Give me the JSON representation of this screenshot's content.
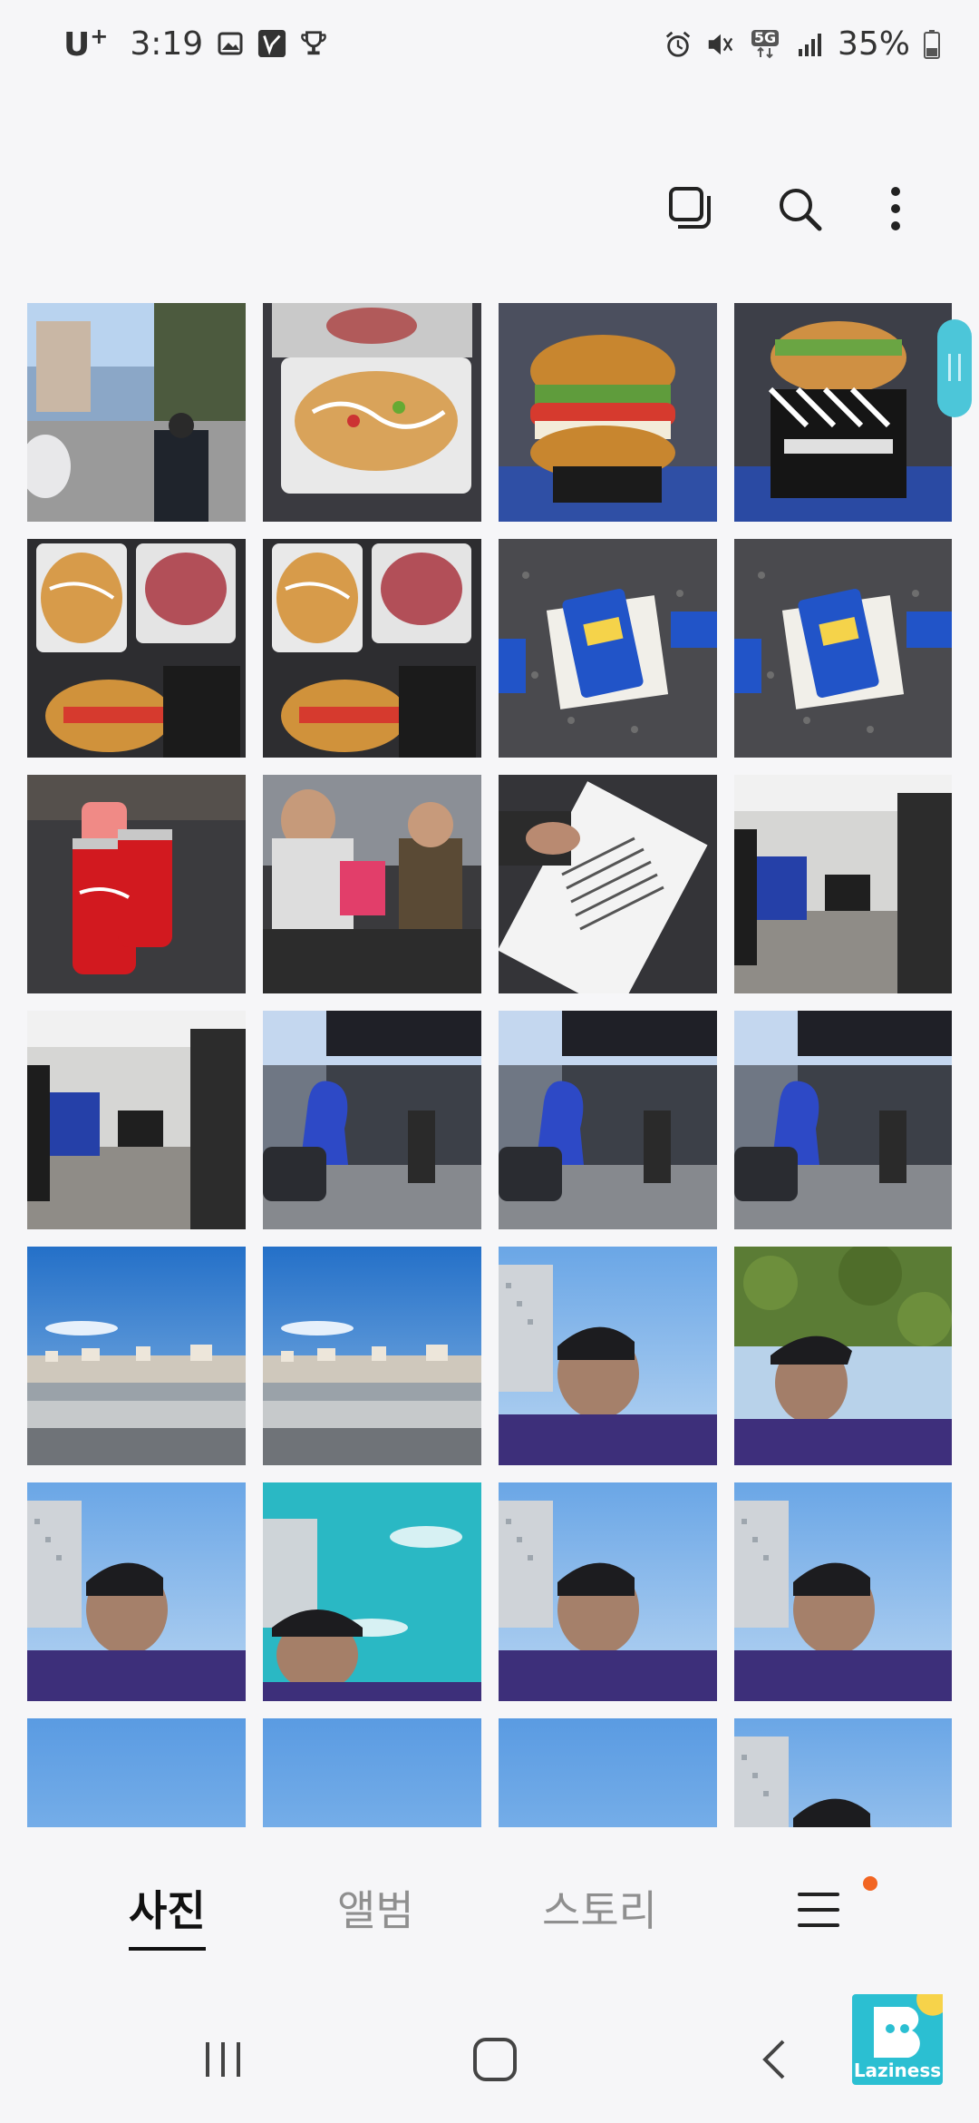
{
  "status_bar": {
    "carrier": "U",
    "carrier_sup": "+",
    "time": "3:19",
    "network": "5G",
    "battery": "35%"
  },
  "toolbar": {
    "icons": [
      "select-icon",
      "search-icon",
      "more-options-icon"
    ]
  },
  "grid": {
    "rows": 7,
    "columns": 4,
    "photos": [
      {
        "scene": "street"
      },
      {
        "scene": "food-tray"
      },
      {
        "scene": "burger"
      },
      {
        "scene": "burger-wrapped"
      },
      {
        "scene": "food-platter"
      },
      {
        "scene": "food-platter"
      },
      {
        "scene": "table-packet"
      },
      {
        "scene": "table-packet"
      },
      {
        "scene": "coke-cans"
      },
      {
        "scene": "people-table"
      },
      {
        "scene": "menu-card"
      },
      {
        "scene": "restaurant-interior"
      },
      {
        "scene": "restaurant-interior"
      },
      {
        "scene": "storefront"
      },
      {
        "scene": "storefront"
      },
      {
        "scene": "storefront"
      },
      {
        "scene": "city-sky"
      },
      {
        "scene": "city-sky"
      },
      {
        "scene": "selfie-sky"
      },
      {
        "scene": "selfie-tree"
      },
      {
        "scene": "selfie-sky"
      },
      {
        "scene": "selfie-teal"
      },
      {
        "scene": "selfie-sky"
      },
      {
        "scene": "selfie-sky"
      },
      {
        "scene": "sky"
      },
      {
        "scene": "sky"
      },
      {
        "scene": "sky"
      },
      {
        "scene": "selfie-sky"
      }
    ]
  },
  "tabs": [
    {
      "label": "사진",
      "active": true
    },
    {
      "label": "앨범",
      "active": false
    },
    {
      "label": "스토리",
      "active": false
    }
  ],
  "watermark": {
    "text": "Laziness"
  },
  "colors": {
    "background": "#f6f6f8",
    "accent_dot": "#f26522",
    "scroll_handle": "#4cc6d9",
    "watermark": "#2bbfd2"
  }
}
